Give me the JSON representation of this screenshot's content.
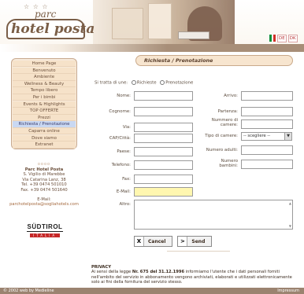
{
  "header": {
    "logo_small": "parc",
    "logo_main": "hotel posta",
    "languages": [
      "DE",
      "DK"
    ],
    "flag_colors": [
      "#0b8f3a",
      "#ffffff",
      "#d22f27"
    ]
  },
  "sidebar": {
    "nav_items": [
      {
        "label": "Home Page",
        "active": false
      },
      {
        "label": "Benvenuto",
        "active": false
      },
      {
        "label": "Ambiente",
        "active": false
      },
      {
        "label": "Wellness & Beauty",
        "active": false
      },
      {
        "label": "Tempo libero",
        "active": false
      },
      {
        "label": "Per i bimbi",
        "active": false
      },
      {
        "label": "Events & Highlights",
        "active": false
      },
      {
        "label": "TOP OFFERTE",
        "active": false
      },
      {
        "label": "Prezzi",
        "active": false
      },
      {
        "label": "Richiesta / Prenotazione",
        "active": true
      },
      {
        "label": "Caparra online",
        "active": false
      },
      {
        "label": "Dove siamo",
        "active": false
      },
      {
        "label": "Extranet",
        "active": false
      }
    ],
    "contact": {
      "separator": "oooo",
      "name": "Parc Hotel Posta",
      "address1": "S. Vigilio di Marebbe",
      "address2": "Via Catarina Lanz, 38",
      "tel": "Tel. +39 0474 501010",
      "fax": "Fax. +39 0474 501640",
      "email_label": "E-Mail:",
      "email": "parchotelposta@sogliahotels.com"
    },
    "brand": {
      "line1": "SÜDTIROL",
      "line2": "ITALIA"
    }
  },
  "main": {
    "title": "Richiesta / Prenotazione",
    "request_type": {
      "label": "Si tratta di une:",
      "options": [
        "Richieste",
        "Prenotazione"
      ]
    },
    "fields_left": [
      {
        "label": "Nome:",
        "value": ""
      },
      {
        "label": "Cognome:",
        "value": ""
      },
      {
        "label": "Via:",
        "value": ""
      },
      {
        "label": "CAP/Città:",
        "value": ""
      },
      {
        "label": "Paese:",
        "value": ""
      },
      {
        "label": "Telefono:",
        "value": ""
      },
      {
        "label": "Fax:",
        "value": ""
      },
      {
        "label": "E-Mail:",
        "value": ""
      }
    ],
    "fields_right": [
      {
        "label": "Arrivo:",
        "value": ""
      },
      {
        "label": "Partenza:",
        "value": ""
      },
      {
        "label": "Nummero di camere:",
        "value": ""
      },
      {
        "label": "Tipo di camere:",
        "value": "-- scegliere --"
      },
      {
        "label": "Numero adulti:",
        "value": ""
      },
      {
        "label": "Numero bambini:",
        "value": ""
      }
    ],
    "notes_label": "Altro:",
    "buttons": {
      "cancel_glyph": "X",
      "cancel_label": "Cancel",
      "send_glyph": ">",
      "send_label": "Send"
    },
    "privacy": {
      "title": "PRIVACY",
      "text_before": "Ai sensi della legge ",
      "law": "Nr. 675 del 31.12.1996",
      "text_after": " informiamo l'utente che i dati personali forniti nell'ambito del servizio in abbonamento vengono archiviati, elaborati e utilizzati elettronicamente solo ai fini della fornitura del servizio stesso."
    }
  },
  "footer": {
    "left": "© 2002 web by Medieline",
    "right": "Impressum"
  }
}
